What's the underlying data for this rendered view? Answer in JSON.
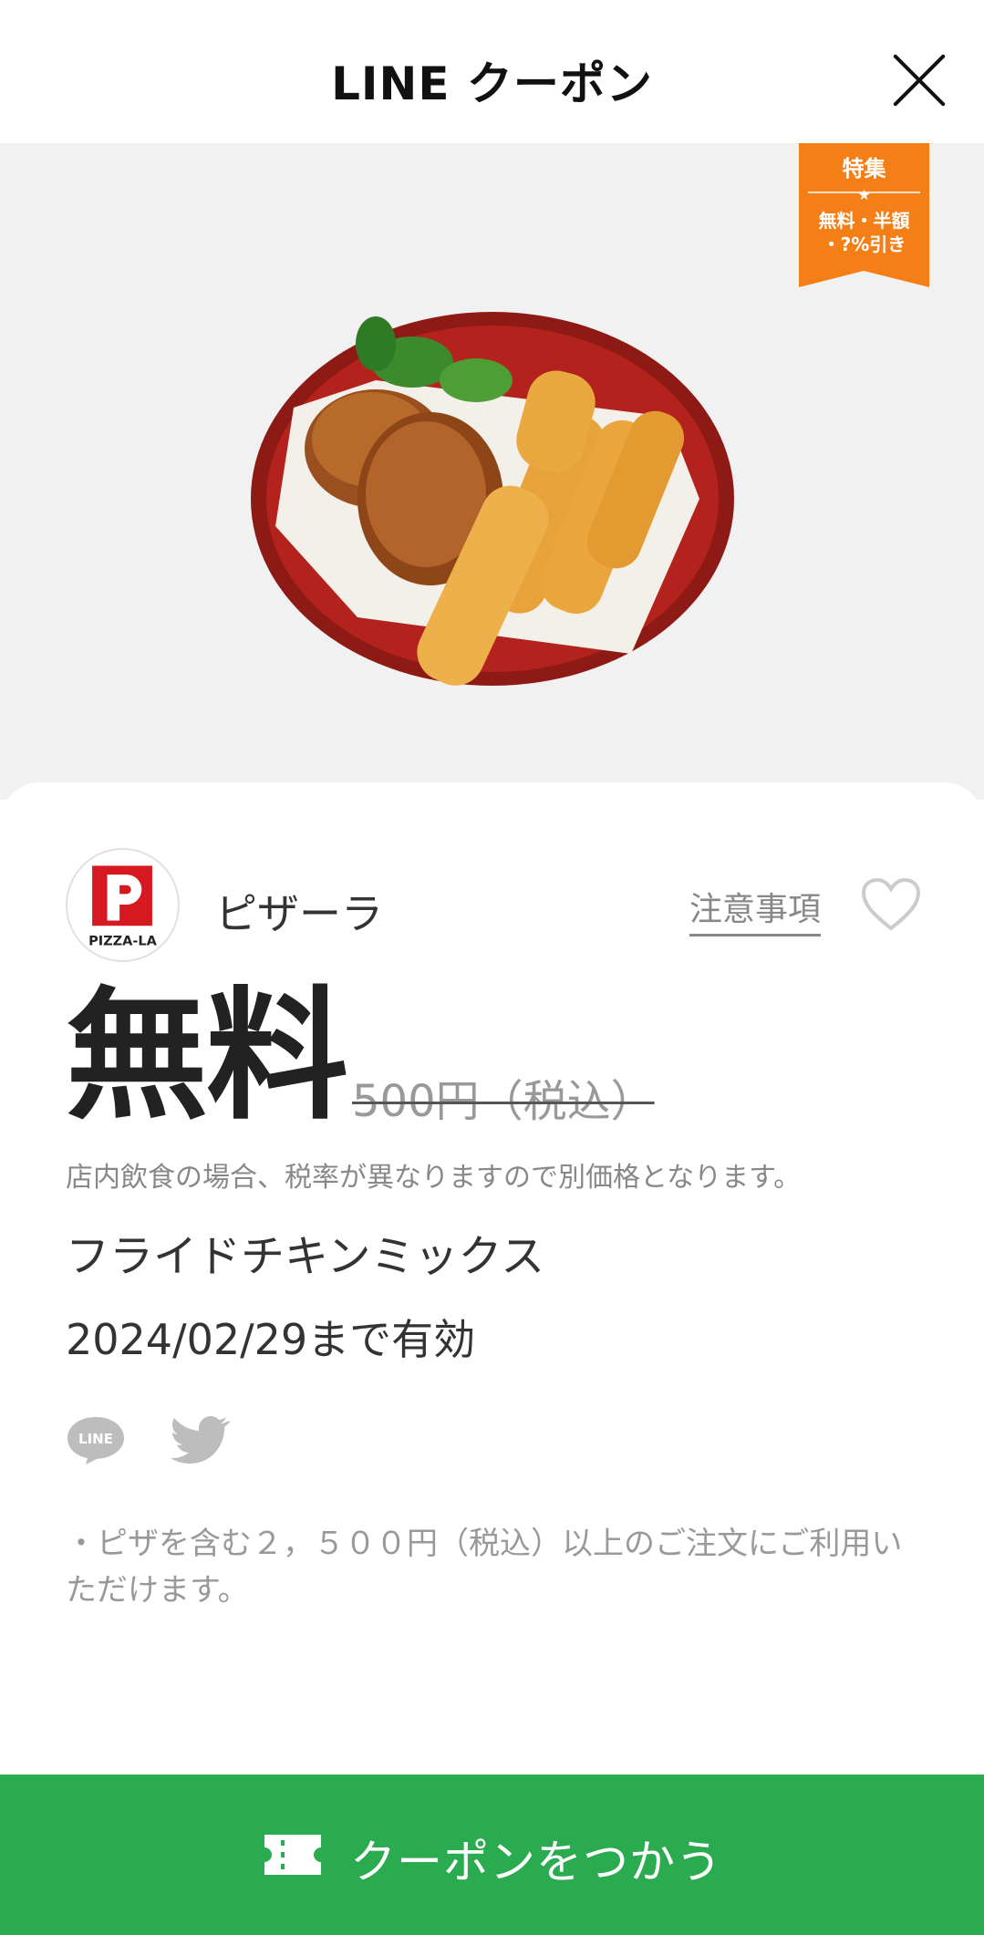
{
  "header": {
    "title": "LINE クーポン",
    "close_icon": "close-icon"
  },
  "hero": {
    "badge": {
      "line1": "特集",
      "star": "★",
      "line2": "無料・半額",
      "line3": "・?%引き",
      "color": "#f57f17"
    },
    "image_subject": "fried chicken and cheese sticks on red plate"
  },
  "store": {
    "name": "ピザーラ",
    "logo_text": "PIZZA-LA",
    "notes_label": "注意事項",
    "favorite_icon": "heart-icon"
  },
  "offer": {
    "price": "無料",
    "original_price": "500円（税込）",
    "tax_note": "店内飲食の場合、税率が異なりますので別価格となります。",
    "product": "フライドチキンミックス",
    "valid_until": "2024/02/29まで有効"
  },
  "share": {
    "line_icon": "line-icon",
    "line_text": "LINE",
    "twitter_icon": "twitter-icon"
  },
  "conditions": {
    "text": "・ピザを含む２，５００円（税込）以上のご注文にご利用いただけます。"
  },
  "action": {
    "use_label": "クーポンをつかう",
    "icon": "ticket-icon",
    "color": "#2bab4f"
  }
}
